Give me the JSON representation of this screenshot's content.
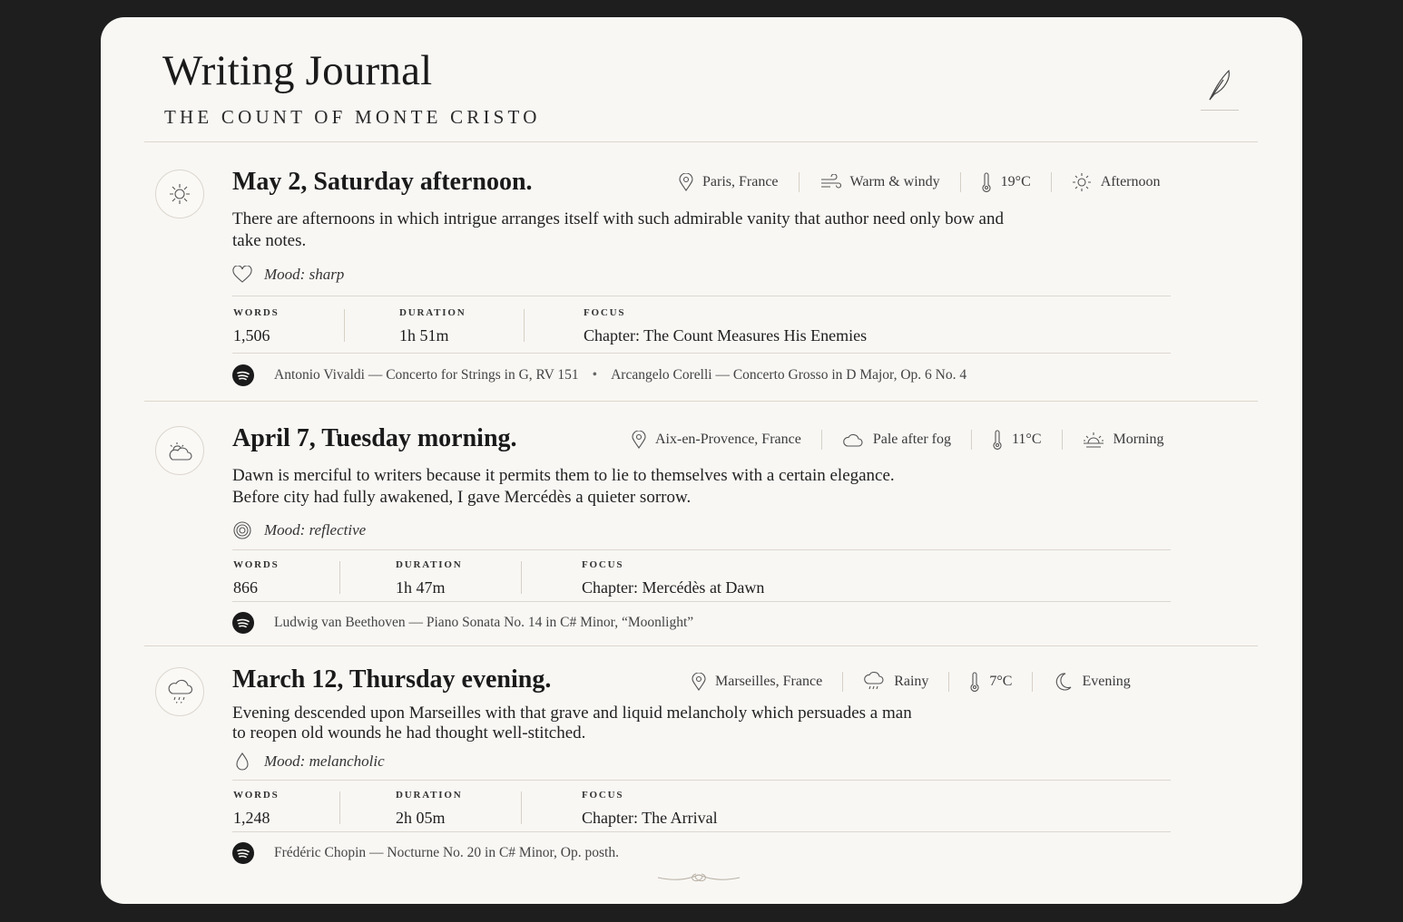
{
  "header": {
    "title": "Writing Journal",
    "subtitle": "THE COUNT OF MONTE CRISTO",
    "quill_icon": "feather-quill-icon"
  },
  "labels": {
    "words": "WORDS",
    "duration": "DURATION",
    "focus": "FOCUS"
  },
  "entries": [
    {
      "icon": "sun-icon",
      "title": "May 2, Saturday afternoon.",
      "location": "Paris, France",
      "weather": "Warm & windy",
      "weather_icon": "wind-icon",
      "temperature": "19°C",
      "time_of_day": "Afternoon",
      "time_icon": "sun-small-icon",
      "text_lines": [
        "There are afternoons in which intrigue arranges itself with such admirable vanity that author need only bow and",
        "take notes."
      ],
      "mood": "Mood: sharp",
      "mood_icon": "heart-icon",
      "words": "1,506",
      "duration": "1h 51m",
      "focus": "Chapter: The Count Measures His Enemies",
      "music": [
        "Antonio Vivaldi — Concerto for Strings in G, RV 151",
        "Arcangelo Corelli — Concerto Grosso in D Major, Op. 6 No. 4"
      ],
      "music_separator": "•"
    },
    {
      "icon": "partly-cloudy-icon",
      "title": "April 7, Tuesday morning.",
      "location": "Aix-en-Provence, France",
      "weather": "Pale after fog",
      "weather_icon": "cloud-icon",
      "temperature": "11°C",
      "time_of_day": "Morning",
      "time_icon": "sunrise-icon",
      "text_lines": [
        "Dawn is merciful to writers because it permits them to lie to themselves with a certain elegance.",
        "Before city had fully awakened, I gave Mercédès a quieter sorrow."
      ],
      "mood": "Mood: reflective",
      "mood_icon": "spiral-icon",
      "words": "866",
      "duration": "1h 47m",
      "focus": "Chapter: Mercédès at Dawn",
      "music": [
        "Ludwig van Beethoven — Piano Sonata No. 14 in C# Minor, “Moonlight”"
      ]
    },
    {
      "icon": "rain-cloud-icon",
      "title": "March 12, Thursday evening.",
      "location": "Marseilles, France",
      "weather": "Rainy",
      "weather_icon": "rain-icon",
      "temperature": "7°C",
      "time_of_day": "Evening",
      "time_icon": "moon-icon",
      "text_lines": [
        "Evening descended upon Marseilles with that grave and liquid melancholy which persuades a man",
        "to reopen old wounds he had thought well-stitched."
      ],
      "mood": "Mood: melancholic",
      "mood_icon": "droplet-icon",
      "words": "1,248",
      "duration": "2h 05m",
      "focus": "Chapter: The Arrival",
      "music": [
        "Frédéric Chopin — Nocturne No. 20 in C# Minor, Op. posth."
      ]
    }
  ]
}
